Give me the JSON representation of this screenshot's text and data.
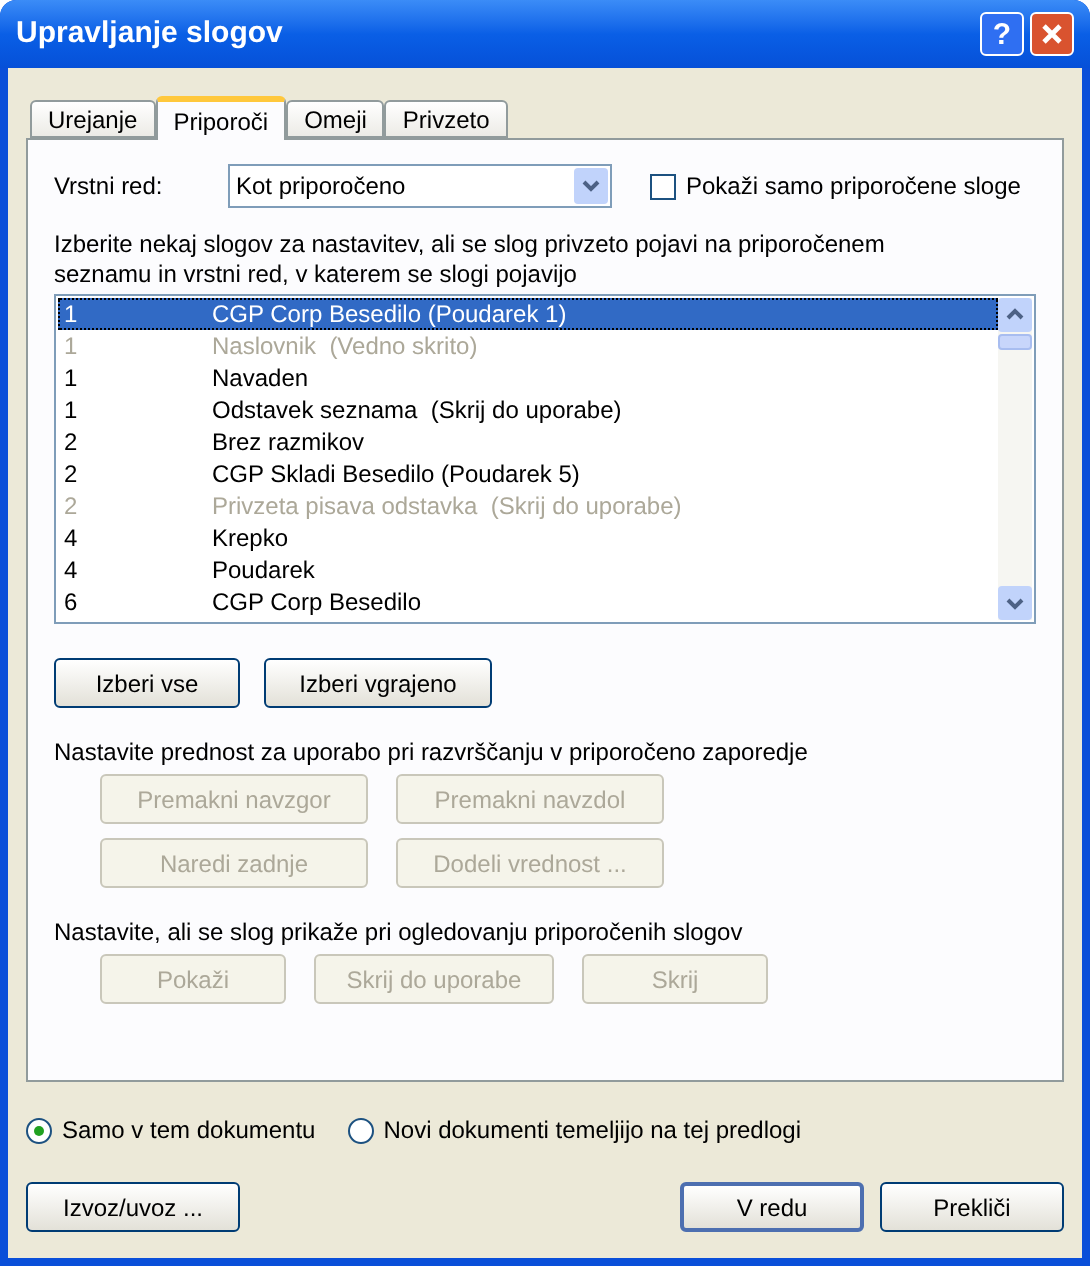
{
  "window": {
    "title": "Upravljanje slogov",
    "help": "?"
  },
  "tabs": [
    {
      "label": "Urejanje",
      "selected": false
    },
    {
      "label": "Priporoči",
      "selected": true
    },
    {
      "label": "Omeji",
      "selected": false
    },
    {
      "label": "Privzeto",
      "selected": false
    }
  ],
  "order": {
    "label": "Vrstni red:",
    "value": "Kot priporočeno"
  },
  "only_recommended": {
    "label": "Pokaži samo priporočene sloge",
    "checked": false
  },
  "instructions": "Izberite nekaj slogov za nastavitev, ali se slog privzeto pojavi na priporočenem seznamu in vrstni red, v katerem se slogi pojavijo",
  "styles": [
    {
      "priority": "1",
      "name": "CGP Corp Besedilo (Poudarek 1)",
      "disabled": false,
      "selected": true
    },
    {
      "priority": "1",
      "name": "Naslovnik  (Vedno skrito)",
      "disabled": true,
      "selected": false
    },
    {
      "priority": "1",
      "name": "Navaden",
      "disabled": false,
      "selected": false
    },
    {
      "priority": "1",
      "name": "Odstavek seznama  (Skrij do uporabe)",
      "disabled": false,
      "selected": false
    },
    {
      "priority": "2",
      "name": "Brez razmikov",
      "disabled": false,
      "selected": false
    },
    {
      "priority": "2",
      "name": "CGP Skladi Besedilo (Poudarek 5)",
      "disabled": false,
      "selected": false
    },
    {
      "priority": "2",
      "name": "Privzeta pisava odstavka  (Skrij do uporabe)",
      "disabled": true,
      "selected": false
    },
    {
      "priority": "4",
      "name": "Krepko",
      "disabled": false,
      "selected": false
    },
    {
      "priority": "4",
      "name": "Poudarek",
      "disabled": false,
      "selected": false
    },
    {
      "priority": "6",
      "name": "CGP Corp Besedilo",
      "disabled": false,
      "selected": false
    }
  ],
  "select_buttons": [
    {
      "label": "Izberi vse",
      "disabled": false
    },
    {
      "label": "Izberi vgrajeno",
      "disabled": false
    }
  ],
  "sections": [
    {
      "label": "Nastavite prednost za uporabo pri razvrščanju v priporočeno zaporedje",
      "buttons": [
        {
          "label": "Premakni navzgor",
          "disabled": true
        },
        {
          "label": "Premakni navzdol",
          "disabled": true
        },
        {
          "label": "Naredi zadnje",
          "disabled": true
        },
        {
          "label": "Dodeli vrednost ...",
          "disabled": true
        }
      ]
    },
    {
      "label": "Nastavite, ali se slog prikaže pri ogledovanju priporočenih slogov",
      "buttons": [
        {
          "label": "Pokaži",
          "disabled": true
        },
        {
          "label": "Skrij do uporabe",
          "disabled": true
        },
        {
          "label": "Skrij",
          "disabled": true
        }
      ]
    }
  ],
  "scope": [
    {
      "label": "Samo v tem dokumentu",
      "selected": true
    },
    {
      "label": "Novi dokumenti temeljijo na tej predlogi",
      "selected": false
    }
  ],
  "footer_buttons": [
    {
      "label": "Izvoz/uvoz ...",
      "default": false
    },
    {
      "label": "V redu",
      "default": true
    },
    {
      "label": "Prekliči",
      "default": false
    }
  ]
}
